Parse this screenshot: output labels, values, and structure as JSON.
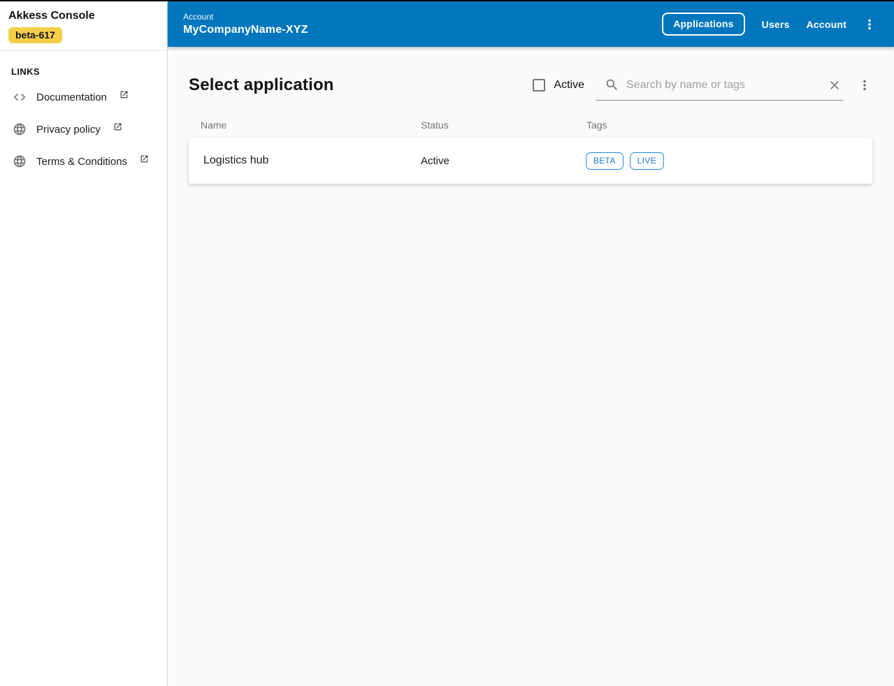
{
  "colors": {
    "header_bg": "#0277BD",
    "badge_bg": "#F5CF4A",
    "chip_border": "#1E88E5",
    "chip_text": "#1976D2"
  },
  "sidebar": {
    "title": "Akkess Console",
    "badge": "beta-617",
    "links_header": "LINKS",
    "items": [
      {
        "label": "Documentation",
        "icon": "code-icon"
      },
      {
        "label": "Privacy policy",
        "icon": "globe-icon"
      },
      {
        "label": "Terms & Conditions",
        "icon": "globe-icon"
      }
    ]
  },
  "header": {
    "eyebrow": "Account",
    "title": "MyCompanyName-XYZ",
    "nav": [
      {
        "label": "Applications",
        "active": true
      },
      {
        "label": "Users",
        "active": false
      },
      {
        "label": "Account",
        "active": false
      }
    ]
  },
  "main": {
    "title": "Select application",
    "filter": {
      "active_label": "Active",
      "checked": false
    },
    "search": {
      "placeholder": "Search by name or tags",
      "value": ""
    },
    "table": {
      "columns": [
        "Name",
        "Status",
        "Tags"
      ],
      "rows": [
        {
          "name": "Logistics hub",
          "status": "Active",
          "tags": [
            "BETA",
            "LIVE"
          ]
        }
      ]
    }
  }
}
